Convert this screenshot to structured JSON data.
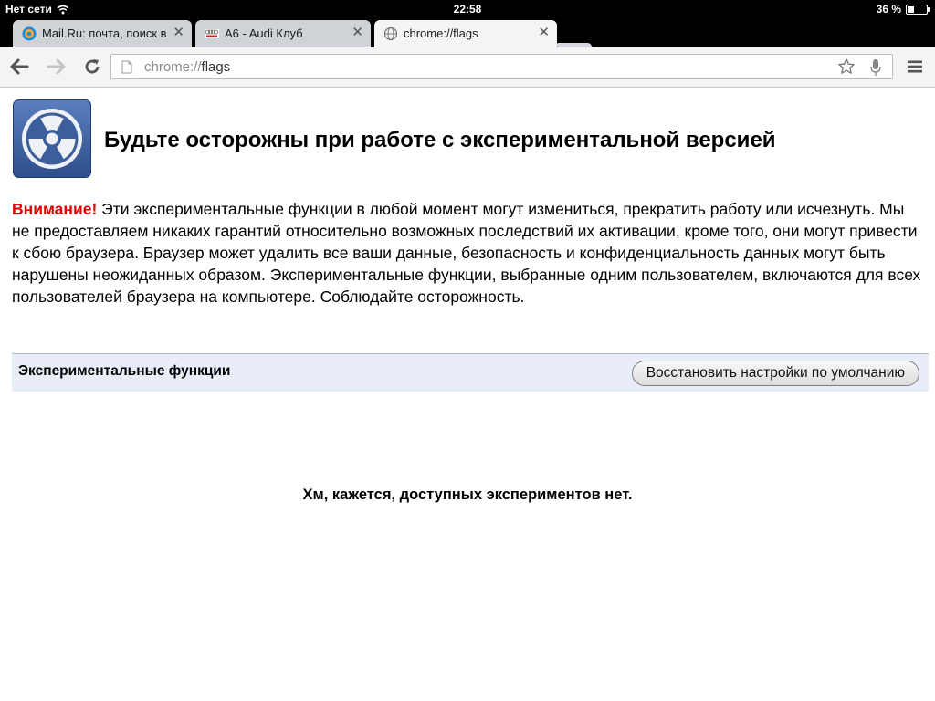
{
  "status_bar": {
    "carrier": "Нет сети",
    "time": "22:58",
    "battery_percent": "36 %",
    "battery_level": 0.36
  },
  "tabs": [
    {
      "title": "Mail.Ru: почта, поиск в и",
      "icon": "mailru-favicon",
      "active": false
    },
    {
      "title": "A6 - Audi Клуб",
      "icon": "audi-club-favicon",
      "active": false
    },
    {
      "title": "chrome://flags",
      "icon": "globe-icon",
      "active": true
    }
  ],
  "toolbar": {
    "url_scheme": "chrome://",
    "url_path": "flags"
  },
  "page": {
    "title": "Будьте осторожны при работе с экспериментальной версией",
    "warning_label": "Внимание!",
    "warning_text": " Эти экспериментальные функции в любой момент могут измениться, прекратить работу или исчезнуть. Мы не предоставляем никаких гарантий относительно возможных последствий их активации, кроме того, они могут привести к сбою браузера. Браузер может удалить все ваши данные, безопасность и конфиденциальность данных могут быть нарушены неожиданных образом. Экспериментальные функции, выбранные одним пользователем, включаются для всех пользователей браузера на компьютере. Соблюдайте осторожность.",
    "section_title": "Экспериментальные функции",
    "reset_button": "Восстановить настройки по умолчанию",
    "empty_message": "Хм, кажется, доступных экспериментов нет."
  },
  "colors": {
    "warning_red": "#e00000",
    "section_bg": "#e8edf7",
    "icon_blue": "#3a5c9a"
  }
}
